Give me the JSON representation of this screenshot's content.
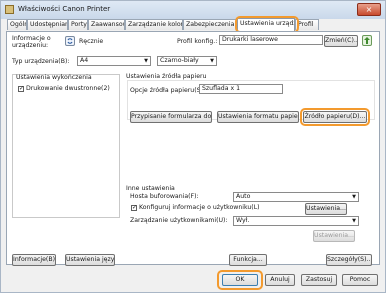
{
  "window": {
    "title": "Właściwości Canon Printer",
    "close_symbol": "×"
  },
  "tabs": [
    "Ogólne",
    "Udostępnianie",
    "Porty",
    "Zaawansowane",
    "Zarządzanie kolorami",
    "Zabezpieczenia",
    "Ustawienia urządzenia",
    "Profil"
  ],
  "top": {
    "info_label": "Informacje o urządzeniu:",
    "mode_value": "Ręcznie",
    "profile_label": "Profil konfig.:",
    "profile_value": "Drukarki laserowe",
    "change_button": "Zmień(C)..."
  },
  "device_row": {
    "type_label": "Typ urządzenia(B):",
    "size_value": "A4",
    "color_value": "Czarno-biały"
  },
  "options": {
    "header": "Ustawienia wykończenia",
    "duplex_label": "Drukowanie dwustronne(2)",
    "duplex_checked": "✓"
  },
  "paper": {
    "header": "Ustawienia źródła papieru",
    "source_label": "Opcje źródła papieru(S):",
    "source_value": "Szuflada x 1",
    "btn_form": "Przypisanie formularza do tacy...",
    "btn_format": "Ustawienia formatu papieru(X)...",
    "btn_source": "Źródło papieru(D)..."
  },
  "other": {
    "header": "Inne ustawienia",
    "font_label": "Hosta buforowania(F):",
    "font_value": "Auto",
    "config_label": "Konfiguruj informacje o użytkowniku(L)",
    "config_checked": "✓",
    "settings_button": "Ustawienia...",
    "manage_label": "Zarządzanie użytkownikami(U):",
    "manage_value": "Wył.",
    "manage_button": "Ustawienia..."
  },
  "bottom_panel": {
    "info_button": "Informacje(B)",
    "language_button": "Ustawienia języka...",
    "function_button": "Funkcja...",
    "details_button": "Szczegóły(S)..."
  },
  "dialog_buttons": {
    "ok": "OK",
    "cancel": "Anuluj",
    "apply": "Zastosuj",
    "help": "Pomoc"
  },
  "colors": {
    "accent_highlight": "#f39a2e",
    "titlebar": "#dfe9f5",
    "close": "#c84a2e"
  },
  "icons": {
    "mode_icon": "sync-icon",
    "upload_icon": "upload-arrow-icon"
  }
}
